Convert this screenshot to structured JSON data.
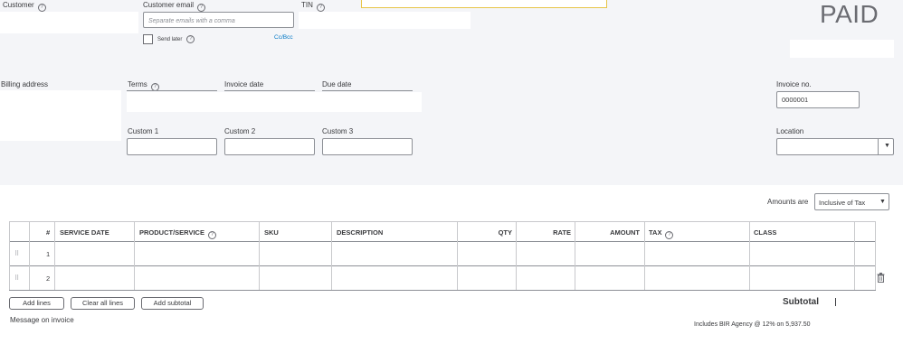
{
  "header": {
    "customer_label": "Customer",
    "email_label": "Customer email",
    "email_placeholder": "Separate emails with a comma",
    "send_later_label": "Send later",
    "cc_bcc_label": "Cc/Bcc",
    "tin_label": "TIN",
    "status": "PAID"
  },
  "details": {
    "billing_address_label": "Billing address",
    "terms_label": "Terms",
    "invoice_date_label": "Invoice date",
    "due_date_label": "Due date",
    "invoice_no_label": "Invoice no.",
    "invoice_no_value": "0000001",
    "custom1_label": "Custom 1",
    "custom2_label": "Custom 2",
    "custom3_label": "Custom 3",
    "location_label": "Location"
  },
  "amounts": {
    "label": "Amounts are",
    "selected": "Inclusive of Tax"
  },
  "table": {
    "columns": [
      "#",
      "SERVICE DATE",
      "PRODUCT/SERVICE",
      "SKU",
      "DESCRIPTION",
      "QTY",
      "RATE",
      "AMOUNT",
      "TAX",
      "CLASS"
    ],
    "rows": [
      {
        "num": "1"
      },
      {
        "num": "2"
      }
    ]
  },
  "actions": {
    "add_lines": "Add lines",
    "clear_all_lines": "Clear all lines",
    "add_subtotal": "Add subtotal"
  },
  "footer": {
    "message_label": "Message on invoice",
    "subtotal_label": "Subtotal",
    "tax_note": "Includes BIR Agency @ 12% on 5,937.50"
  },
  "icons": [
    "help-icon",
    "dropdown-caret-icon",
    "drag-handle-icon",
    "trash-icon"
  ]
}
